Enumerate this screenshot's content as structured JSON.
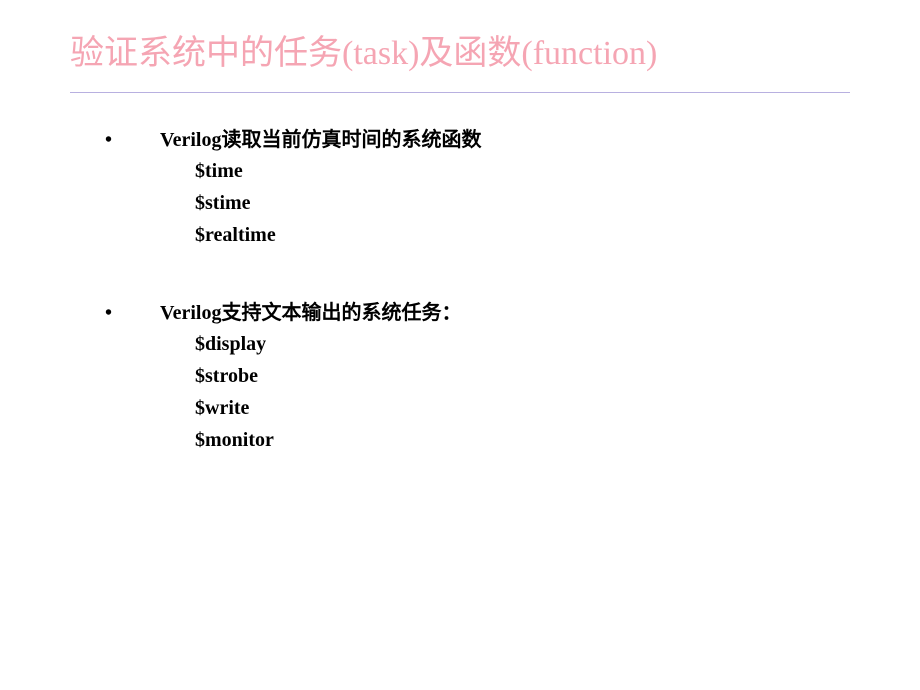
{
  "title": "验证系统中的任务(task)及函数(function)",
  "section1": {
    "heading": "Verilog读取当前仿真时间的系统函数",
    "items": [
      "$time",
      "$stime",
      "$realtime"
    ]
  },
  "section2": {
    "heading": "Verilog支持文本输出的系统任务：",
    "items": [
      "$display",
      "$strobe",
      "$write",
      "$monitor"
    ]
  }
}
